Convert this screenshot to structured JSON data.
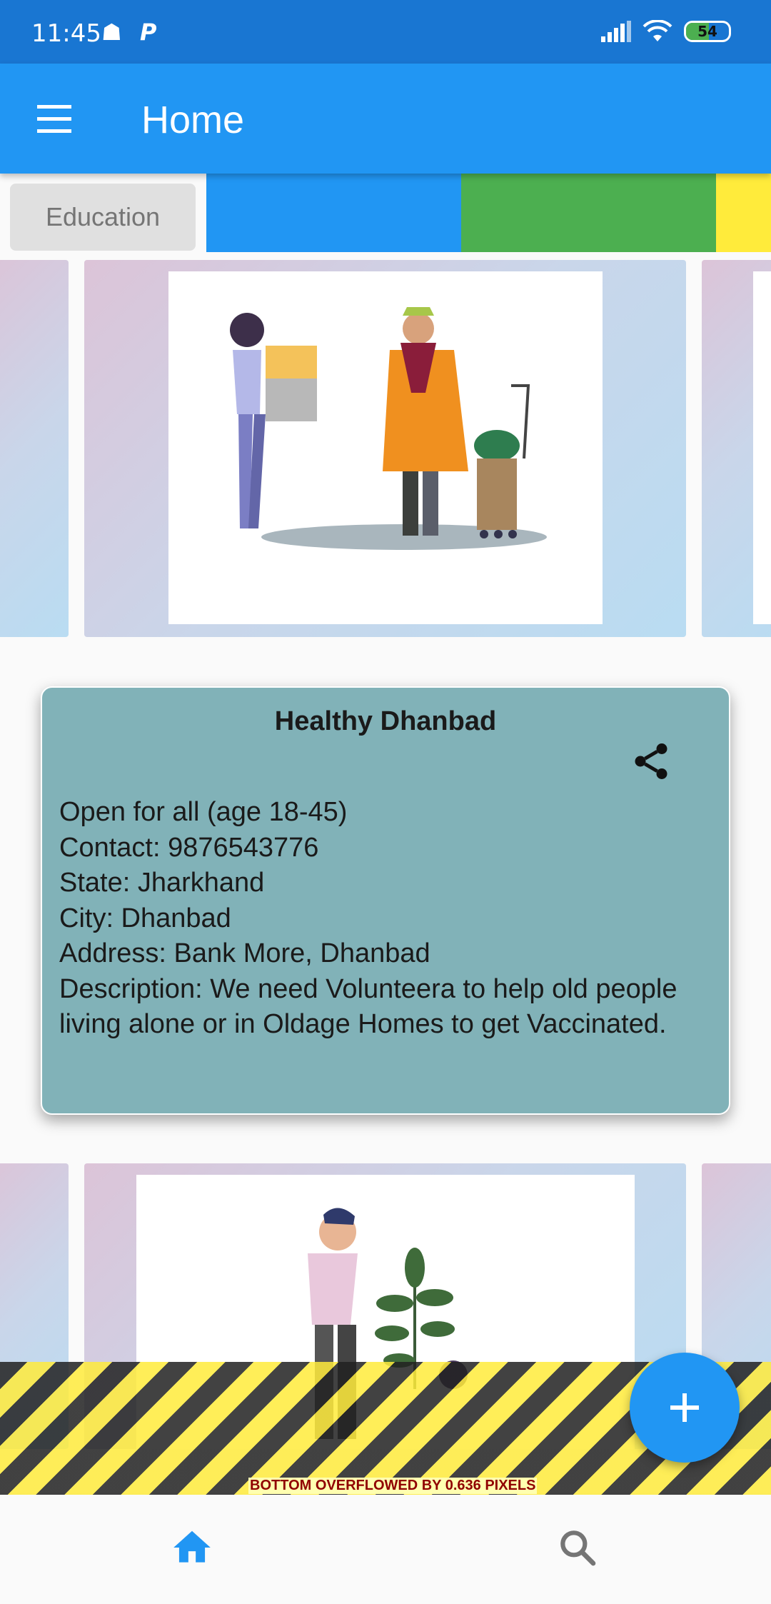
{
  "status_bar": {
    "time": "11:45",
    "notif_glyph_1": "☗",
    "notif_glyph_2": "P",
    "battery_level": "54",
    "battery_fraction": 0.54
  },
  "app_bar": {
    "title": "Home",
    "menu_icon": "menu-icon"
  },
  "categories": {
    "chip_label": "Education",
    "colors": [
      "#2196f3",
      "#4caf50",
      "#ffeb3b"
    ]
  },
  "card": {
    "title": "Healthy Dhanbad",
    "share_icon": "share-icon",
    "lines": [
      "Open for all (age 18-45)",
      "Contact: 9876543776",
      "State: Jharkhand",
      "City: Dhanbad",
      "Address: Bank More, Dhanbad",
      "Description: We need Volunteera to help old people living alone or in Oldage Homes to get Vaccinated."
    ],
    "background": "#81b2b8"
  },
  "overflow_warning": "BOTTOM OVERFLOWED BY 0.636 PIXELS",
  "fab": {
    "icon": "add-icon"
  },
  "bottom_nav": {
    "items": [
      {
        "icon": "home-icon",
        "active": true
      },
      {
        "icon": "search-icon",
        "active": false
      }
    ],
    "active_color": "#2196f3",
    "inactive_color": "#757575"
  },
  "colors": {
    "status_bar": "#1976d2",
    "app_bar": "#2196f3",
    "accent": "#2196f3"
  }
}
